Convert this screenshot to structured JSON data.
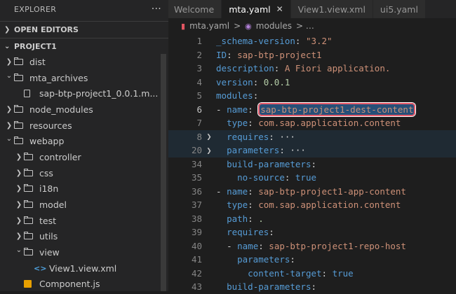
{
  "sidebar": {
    "title": "EXPLORER",
    "more": "···",
    "open_editors": "OPEN EDITORS",
    "project": "PROJECT1",
    "items": [
      {
        "label": "dist",
        "kind": "folder",
        "depth": 0,
        "open": false
      },
      {
        "label": "mta_archives",
        "kind": "folder",
        "depth": 0,
        "open": true
      },
      {
        "label": "sap-btp-project1_0.0.1.m...",
        "kind": "file",
        "depth": 1
      },
      {
        "label": "node_modules",
        "kind": "folder",
        "depth": 0,
        "open": false
      },
      {
        "label": "resources",
        "kind": "folder",
        "depth": 0,
        "open": false
      },
      {
        "label": "webapp",
        "kind": "folder",
        "depth": 0,
        "open": true
      },
      {
        "label": "controller",
        "kind": "folder",
        "depth": 1,
        "open": false
      },
      {
        "label": "css",
        "kind": "folder",
        "depth": 1,
        "open": false
      },
      {
        "label": "i18n",
        "kind": "folder",
        "depth": 1,
        "open": false
      },
      {
        "label": "model",
        "kind": "folder",
        "depth": 1,
        "open": false
      },
      {
        "label": "test",
        "kind": "folder",
        "depth": 1,
        "open": false
      },
      {
        "label": "utils",
        "kind": "folder",
        "depth": 1,
        "open": false
      },
      {
        "label": "view",
        "kind": "folder",
        "depth": 1,
        "open": true
      },
      {
        "label": "View1.view.xml",
        "kind": "xml",
        "depth": 2
      },
      {
        "label": "Component.js",
        "kind": "js",
        "depth": 1
      }
    ]
  },
  "tabs": [
    {
      "label": "Welcome",
      "active": false
    },
    {
      "label": "mta.yaml",
      "active": true,
      "close": "✕"
    },
    {
      "label": "View1.view.xml",
      "active": false
    },
    {
      "label": "ui5.yaml",
      "active": false
    }
  ],
  "breadcrumb": {
    "file": "mta.yaml",
    "sep": ">",
    "section": "modules",
    "more": "> …"
  },
  "code": [
    {
      "n": "1",
      "text": "_schema-version: \"3.2\""
    },
    {
      "n": "2",
      "text": "ID: sap-btp-project1"
    },
    {
      "n": "3",
      "text": "description: A Fiori application."
    },
    {
      "n": "4",
      "text": "version: 0.0.1"
    },
    {
      "n": "5",
      "text": "modules:"
    },
    {
      "n": "6",
      "text": "- name: sap-btp-project1-dest-content"
    },
    {
      "n": "7",
      "text": "  type: com.sap.application.content"
    },
    {
      "n": "8",
      "text": "  requires: ···"
    },
    {
      "n": "20",
      "text": "  parameters: ···"
    },
    {
      "n": "34",
      "text": "  build-parameters:"
    },
    {
      "n": "35",
      "text": "    no-source: true"
    },
    {
      "n": "36",
      "text": "- name: sap-btp-project1-app-content"
    },
    {
      "n": "37",
      "text": "  type: com.sap.application.content"
    },
    {
      "n": "38",
      "text": "  path: ."
    },
    {
      "n": "39",
      "text": "  requires:"
    },
    {
      "n": "40",
      "text": "  - name: sap-btp-project1-repo-host"
    },
    {
      "n": "41",
      "text": "    parameters:"
    },
    {
      "n": "42",
      "text": "      content-target: true"
    },
    {
      "n": "43",
      "text": "  build-parameters:"
    }
  ],
  "colors": {
    "selection_outline": "#e65a6a",
    "accent": "#264f78"
  }
}
